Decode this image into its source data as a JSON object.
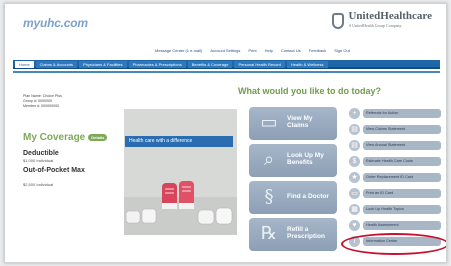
{
  "header": {
    "logo": "myuhc.com",
    "brand_name": "UnitedHealthcare",
    "brand_tagline": "A UnitedHealth Group Company"
  },
  "utility_links": [
    "Message Center (1 e-mail)",
    "Account Settings",
    "Print",
    "Help",
    "Contact Us",
    "Feedback",
    "Sign Out"
  ],
  "nav": {
    "tabs": [
      "Home",
      "Claims & Accounts",
      "Physicians & Facilities",
      "Pharmacies & Prescriptions",
      "Benefits & Coverage",
      "Personal Health Record",
      "Health & Wellness"
    ]
  },
  "member": {
    "lines": [
      "Plan Name: Choice Plus",
      "Group #: 0000000",
      "Member #: 000000000"
    ]
  },
  "coverage": {
    "title": "My Coverage",
    "badge": "Details",
    "deductible_title": "Deductible",
    "deductible_value": "$1,000 Individual",
    "oop_title": "Out-of-Pocket Max",
    "oop_value": "$2,500 Individual"
  },
  "banner": {
    "label": "Health care with a difference"
  },
  "actions": {
    "question": "What would you like to do today?",
    "tiles": [
      {
        "label": "View My Claims",
        "icon": "claims-icon",
        "glyph": "▭"
      },
      {
        "label": "Look Up My Benefits",
        "icon": "magnifier-icon",
        "glyph": "⌕"
      },
      {
        "label": "Find a Doctor",
        "icon": "stethoscope-icon",
        "glyph": "§"
      },
      {
        "label": "Refill a Prescription",
        "icon": "rx-icon",
        "glyph": "℞"
      }
    ]
  },
  "quick_links": [
    {
      "label": "Referrals for Action",
      "icon": "plus-icon",
      "glyph": "+"
    },
    {
      "label": "View Claims Statement",
      "icon": "document-icon",
      "glyph": "▤"
    },
    {
      "label": "View Annual Statement",
      "icon": "statement-icon",
      "glyph": "▤"
    },
    {
      "label": "Estimate Health Care Costs",
      "icon": "calculator-icon",
      "glyph": "$"
    },
    {
      "label": "Order Replacement ID Card",
      "icon": "star-icon",
      "glyph": "★"
    },
    {
      "label": "Print an ID Card",
      "icon": "card-icon",
      "glyph": "▭"
    },
    {
      "label": "Look Up Health Topics",
      "icon": "book-icon",
      "glyph": "▦"
    },
    {
      "label": "Health Assessment",
      "icon": "heart-icon",
      "glyph": "♥"
    },
    {
      "label": "Information Center",
      "icon": "info-icon",
      "glyph": "i"
    }
  ],
  "colors": {
    "nav_blue": "#1f66a8",
    "coverage_green": "#7ea957",
    "highlight_red": "#c8102e"
  }
}
